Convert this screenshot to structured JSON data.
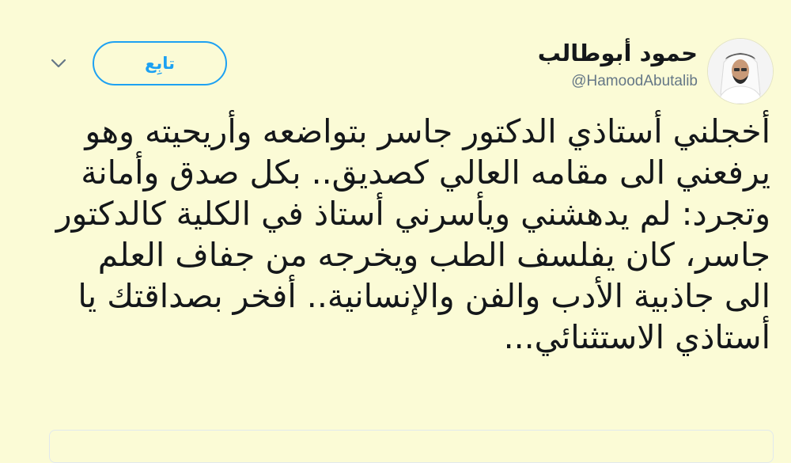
{
  "profile": {
    "name": "حمود أبوطالب",
    "handle": "@HamoodAbutalib",
    "avatar_icon": "person-avatar-icon"
  },
  "actions": {
    "follow_label": "تابِع",
    "more_icon": "chevron-down-icon"
  },
  "tweet": {
    "text": "أخجلني أستاذي الدكتور جاسر بتواضعه وأريحيته وهو يرفعني الى مقامه العالي كصديق.. بكل صدق وأمانة وتجرد: لم يدهشني ويأسرني أستاذ في الكلية كالدكتور جاسر، كان يفلسف الطب ويخرجه من جفاف العلم الى جاذبية الأدب والفن والإنسانية.. أفخر بصداقتك يا أستاذي الاستثنائي..."
  },
  "colors": {
    "background": "#fbfbd6",
    "accent": "#1da1f2",
    "text": "#14171a",
    "muted": "#657786"
  }
}
